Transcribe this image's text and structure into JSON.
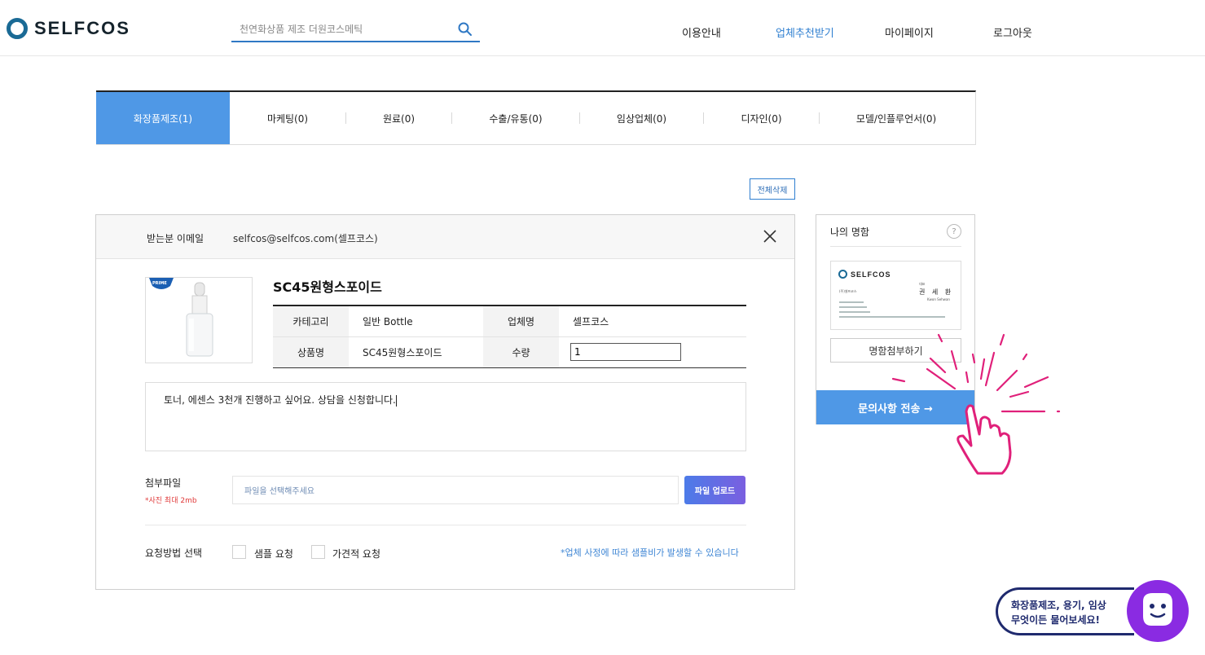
{
  "header": {
    "logo_text": "SELFCOS",
    "search_placeholder": "천연화상품 제조 더원코스메틱",
    "nav": [
      "이용안내",
      "업체추천받기",
      "마이페이지",
      "로그아웃"
    ],
    "active_nav": "업체추천받기"
  },
  "tabs": [
    {
      "label": "화장품제조(1)",
      "active": true
    },
    {
      "label": "마케팅(0)",
      "active": false
    },
    {
      "label": "원료(0)",
      "active": false
    },
    {
      "label": "수출/유통(0)",
      "active": false
    },
    {
      "label": "임상업체(0)",
      "active": false
    },
    {
      "label": "디자인(0)",
      "active": false
    },
    {
      "label": "모델/인플루언서(0)",
      "active": false
    }
  ],
  "delete_all_label": "전체삭제",
  "inquiry": {
    "recipient_label": "받는분 이메일",
    "recipient_email": "selfcos@selfcos.com(셀프코스)",
    "product_badge": "PRIME",
    "product_title": "SC45원형스포이드",
    "table": {
      "category_label": "카테고리",
      "category_value": "일반 Bottle",
      "company_label": "업체명",
      "company_value": "셀프코스",
      "product_label": "상품명",
      "product_value": "SC45원형스포이드",
      "quantity_label": "수량",
      "quantity_value": "1"
    },
    "message": "토너, 에센스 3천개 진행하고 싶어요. 상담을 신청합니다.",
    "attach_label": "첨부파일",
    "attach_note": "*사진 최대 2mb",
    "file_placeholder": "파일을 선택해주세요",
    "upload_label": "파일 업로드",
    "request_label": "요청방법 선택",
    "options": [
      "샘플 요청",
      "가견적 요청"
    ],
    "notice": "*업체 사정에 따라 샘플비가 발생할 수 있습니다"
  },
  "side": {
    "title": "나의 명함",
    "help_icon": "?",
    "card": {
      "logo_text": "SELFCOS",
      "company": "(주)셀프코스",
      "name": "권 세 환",
      "name_en": "Kwon Sehwan",
      "title": "대표"
    },
    "attach_card_label": "명함첨부하기",
    "send_label": "문의사항 전송 →"
  },
  "chat": {
    "line1": "화장품제조, 용기, 임상",
    "line2": "무엇이든 물어보세요!"
  },
  "colors": {
    "accent": "#4f98e6",
    "brand": "#1a6a95",
    "pointer": "#e0207a",
    "chat_border": "#1f2a6e",
    "chat_bot": "#8a2be2"
  }
}
